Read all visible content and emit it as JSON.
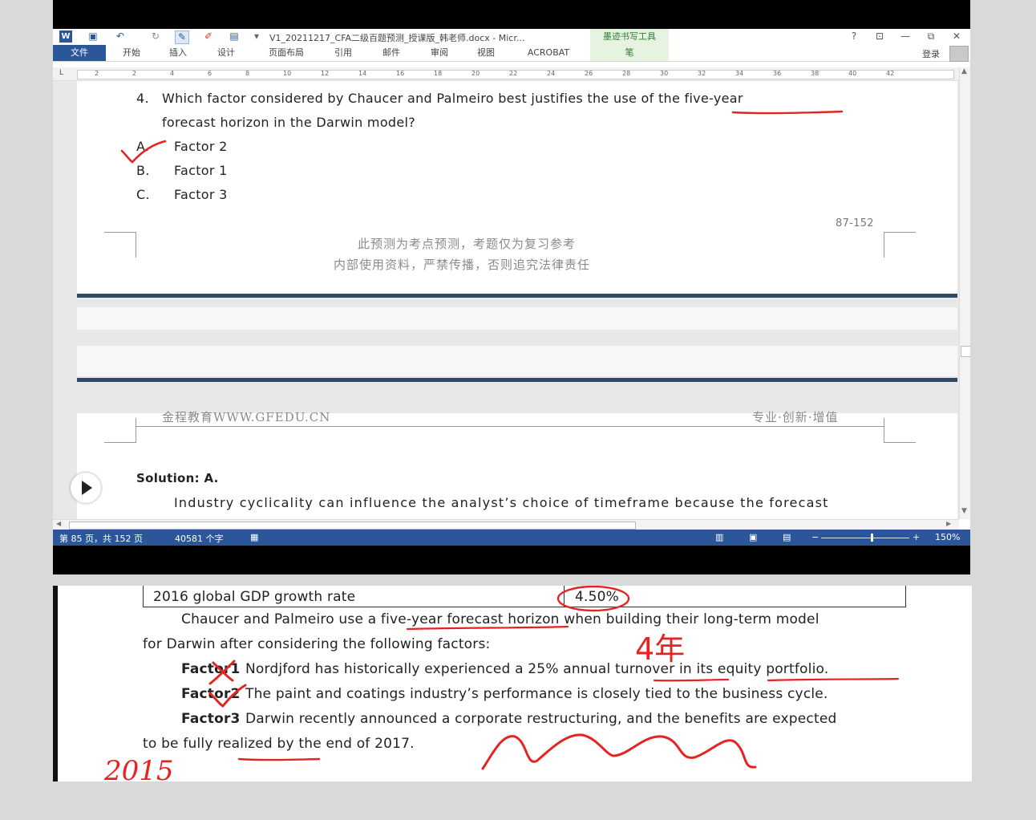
{
  "app": {
    "doc_title": "V1_20211217_CFA二级百题预测_授课版_韩老师.docx - Micr...",
    "ink_tools_title": "墨迹书写工具",
    "help": "?",
    "login": "登录"
  },
  "ribbon": {
    "tabs": [
      "文件",
      "开始",
      "插入",
      "设计",
      "页面布局",
      "引用",
      "邮件",
      "审阅",
      "视图",
      "ACROBAT",
      "笔"
    ]
  },
  "ruler": {
    "numbers": [
      "2",
      "2",
      "4",
      "6",
      "8",
      "10",
      "12",
      "14",
      "16",
      "18",
      "20",
      "22",
      "24",
      "26",
      "28",
      "30",
      "32",
      "34",
      "36",
      "38",
      "40",
      "42"
    ]
  },
  "question": {
    "number": "4.",
    "line1": "Which factor considered by Chaucer and Palmeiro best justifies the use of the five-year",
    "line2": "forecast horizon in the Darwin model?",
    "options": [
      {
        "letter": "A.",
        "text": "Factor 2"
      },
      {
        "letter": "B.",
        "text": "Factor 1"
      },
      {
        "letter": "C.",
        "text": "Factor 3"
      }
    ]
  },
  "page1_footer": {
    "page_number": "87-152",
    "watermark_line1": "此预测为考点预测，考题仅为复习参考",
    "watermark_line2": "内部使用资料，严禁传播，否则追究法律责任"
  },
  "page2_header": {
    "left": "金程教育WWW.GFEDU.CN",
    "right": "专业·创新·增值"
  },
  "solution": {
    "label": "Solution: A.",
    "text": "Industry cyclicality can influence the analyst’s choice of timeframe because the forecast"
  },
  "status_bar": {
    "page": "第 85 页，共 152 页",
    "words": "40581 个字",
    "zoom": "150%",
    "zoom_level_percent": 150
  },
  "excerpt": {
    "gdp_label": "2016 global GDP growth rate",
    "gdp_value": "4.50%",
    "intro_line1": "Chaucer and Palmeiro use a five-year forecast horizon when building their long-term model",
    "intro_line2": "for Darwin after considering the following factors:",
    "factors": [
      {
        "label": "Factor1",
        "text": "Nordjford has historically experienced a 25% annual turnover in its equity portfolio."
      },
      {
        "label": "Factor2",
        "text": "The paint and coatings industry’s performance is closely tied to the business cycle."
      },
      {
        "label": "Factor3",
        "text": "Darwin recently announced a corporate restructuring, and the benefits are expected"
      }
    ],
    "factor3_line2": "to be fully realized by the end of 2017."
  },
  "annotations": {
    "handwriting_years": "4年",
    "handwriting_2015": "2015",
    "ink_color": "#e52421"
  }
}
